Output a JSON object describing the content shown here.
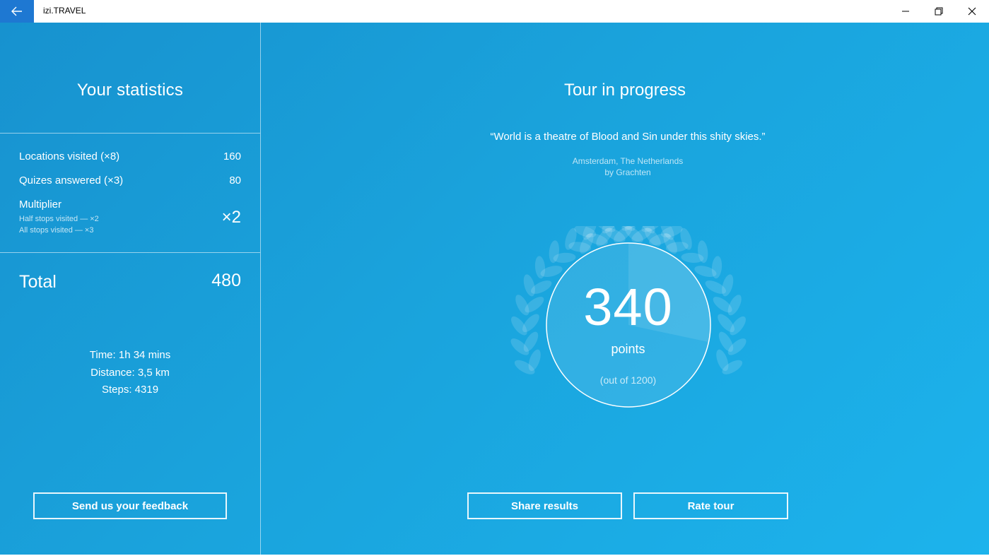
{
  "window": {
    "title": "izi.TRAVEL",
    "accent_color": "#1e78d2",
    "controls": [
      "back-arrow-icon",
      "minimize-icon",
      "restore-icon",
      "close-icon"
    ]
  },
  "theme": {
    "gradient_start": "#1792cf",
    "gradient_end": "#1cb3ec"
  },
  "stats": {
    "title": "Your statistics",
    "rows": [
      {
        "label": "Locations visited (×8)",
        "value": "160"
      },
      {
        "label": "Quizes answered (×3)",
        "value": "80"
      }
    ],
    "multiplier": {
      "label": "Multiplier",
      "value": "×2",
      "notes": [
        "Half stops visited — ×2",
        "All stops visited — ×3"
      ]
    },
    "total": {
      "label": "Total",
      "value": "480"
    },
    "metrics": [
      "Time: 1h 34 mins",
      "Distance: 3,5 km",
      "Steps: 4319"
    ],
    "feedback_button": "Send us your feedback"
  },
  "tour": {
    "title": "Tour in progress",
    "quote": "“World is a theatre of Blood and Sin under this shity skies.”",
    "location": "Amsterdam, The Netherlands",
    "author": "by Grachten",
    "score": {
      "points": "340",
      "unit": "points",
      "out_of": "(out of 1200)",
      "progress_fraction": 0.2833
    },
    "share_button": "Share results",
    "rate_button": "Rate tour"
  }
}
